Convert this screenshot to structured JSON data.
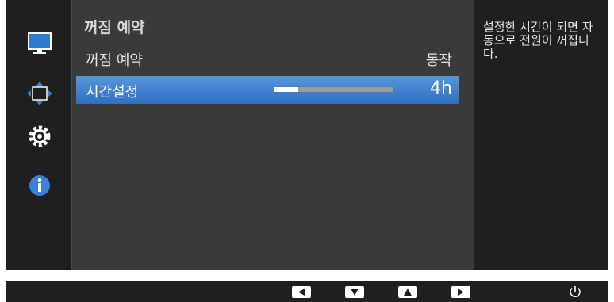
{
  "menu": {
    "section_title": "꺼짐 예약",
    "items": [
      {
        "label": "꺼짐 예약",
        "value": "동작"
      },
      {
        "label": "시간설정",
        "value": "4h"
      }
    ],
    "timer_slider_level": 0.2
  },
  "help": {
    "text": "설정한 시간이 되면 자동으로 전원이 꺼집니다."
  },
  "sidebar": {
    "icons": [
      "monitor-picture-icon",
      "screen-size-position-icon",
      "settings-gear-icon",
      "information-icon"
    ]
  },
  "bottom_bar": {
    "keys": [
      "left-arrow-key-icon",
      "down-arrow-key-icon",
      "up-arrow-key-icon",
      "right-arrow-key-icon",
      "power-icon"
    ]
  },
  "colors": {
    "accent": "#3d7fcf",
    "info_blue": "#3b82d6",
    "panel": "#3a3a3a",
    "background": "#1f1f1f"
  }
}
